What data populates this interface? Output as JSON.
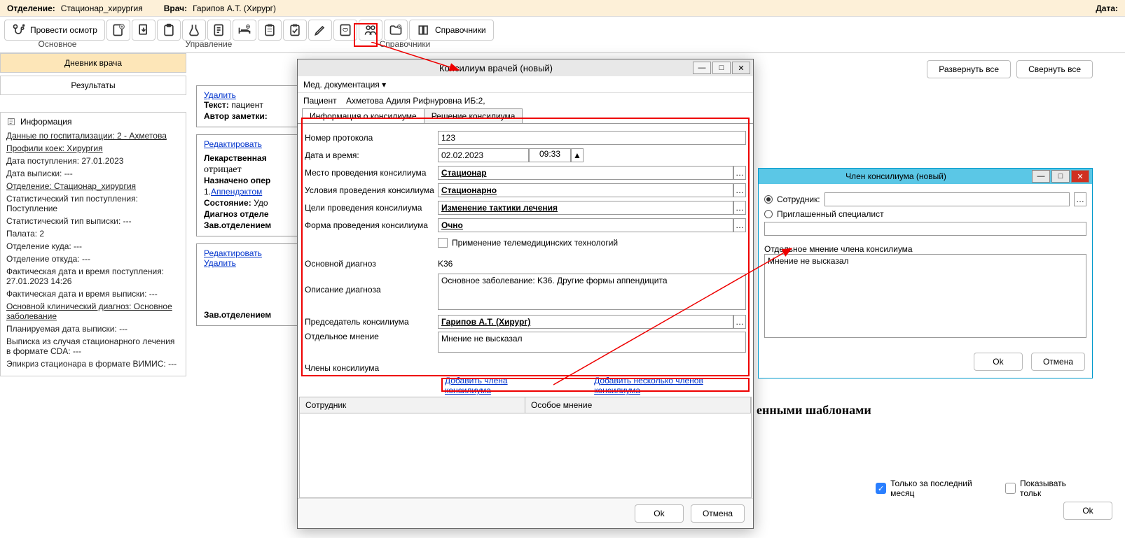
{
  "header": {
    "dept_label": "Отделение:",
    "dept_value": "Стационар_хирургия",
    "doctor_label": "Врач:",
    "doctor_value": "Гарипов А.Т. (Хирург)",
    "date_label": "Дата:"
  },
  "toolbar": {
    "examine": "Провести осмотр",
    "reference": "Справочники",
    "group_main": "Основное",
    "group_manage": "Управление",
    "group_ref": "Справочники"
  },
  "left": {
    "tab1": "Дневник врача",
    "tab2": "Результаты",
    "info_header": "Информация",
    "lines": [
      {
        "t": "Данные по госпитализации: 2 - Ахметова",
        "u": true
      },
      {
        "t": "Профили коек: Хирургия",
        "u": true
      },
      {
        "t": "Дата поступления: 27.01.2023",
        "u": false
      },
      {
        "t": "Дата выписки: ---",
        "u": false
      },
      {
        "t": "Отделение: Стационар_хирургия",
        "u": true
      },
      {
        "t": "Статистический тип поступления: Поступление",
        "u": false
      },
      {
        "t": "Статистический тип выписки: ---",
        "u": false
      },
      {
        "t": "Палата: 2",
        "u": false
      },
      {
        "t": "Отделение куда: ---",
        "u": false
      },
      {
        "t": "Отделение откуда: ---",
        "u": false
      },
      {
        "t": "Фактическая дата и время поступления: 27.01.2023 14:26",
        "u": false
      },
      {
        "t": "Фактическая дата и время выписки: ---",
        "u": false
      },
      {
        "t": "Основной клинический диагноз: Основное заболевание",
        "u": true
      },
      {
        "t": "Планируемая дата выписки: ---",
        "u": false
      },
      {
        "t": "Выписка из случая стационарного лечения в формате CDA: ---",
        "u": false
      },
      {
        "t": "Эпикриз стационара в формате ВИМИС: ---",
        "u": false
      }
    ]
  },
  "mid": {
    "expand": "Развернуть все",
    "collapse": "Свернуть все",
    "delete": "Удалить",
    "text_label": "Текст:",
    "text_val": "пациент ",
    "author_label": "Автор заметки:",
    "edit": "Редактировать",
    "rx_label": "Лекарственная",
    "rx_val": "отрицает",
    "op_label": "Назначено опер",
    "op_num": "1.",
    "op_link": "Аппендэктом",
    "state_label": "Состояние:",
    "state_val": "Удо",
    "diag_label": "Диагноз отделе",
    "head_label": "Зав.отделением",
    "templates_label": "енными шаблонами",
    "last_month": "Только за последний месяц",
    "show_only": "Показывать тольк",
    "ok": "Ok"
  },
  "modal": {
    "title": "Консилиум врачей (новый)",
    "menu": "Мед. документация ▾",
    "patient_label": "Пациент",
    "patient_value": "Ахметова Адиля Рифнуровна ИБ:2,",
    "tab_info": "Информация о консилиуме",
    "tab_decision": "Решение консилиума",
    "f_protocol": "Номер протокола",
    "v_protocol": "123",
    "f_datetime": "Дата и время:",
    "v_date": "02.02.2023",
    "v_time": "09:33",
    "f_place": "Место проведения консилиума",
    "v_place": "Стационар",
    "f_cond": "Условия проведения консилиума",
    "v_cond": "Стационарно",
    "f_goal": "Цели проведения консилиума",
    "v_goal": "Изменение тактики лечения",
    "f_form": "Форма проведения консилиума",
    "v_form": "Очно",
    "f_tele": "Применение телемедицинских технологий",
    "f_maind": "Основной диагноз",
    "v_maind": "K36",
    "f_descd": "Описание диагноза",
    "v_descd": "Основное заболевание: K36. Другие формы аппендицита",
    "f_chair": "Председатель консилиума",
    "v_chair": "Гарипов А.Т. (Хирург)",
    "f_opinion": "Отдельное мнение",
    "v_opinion": "Мнение не высказал",
    "members_label": "Члены консилиума",
    "add_one": "Добавить члена консилиума",
    "add_many": "Добавить несколько членов консилиума",
    "col_emp": "Сотрудник",
    "col_op": "Особое мнение",
    "ok": "Ok",
    "cancel": "Отмена"
  },
  "modal2": {
    "title": "Член консилиума (новый)",
    "r_employee": "Сотрудник:",
    "r_guest": "Приглашенный специалист",
    "opinion_label": "Отдельное мнение члена консилиума",
    "opinion_val": "Мнение не высказал",
    "ok": "Ok",
    "cancel": "Отмена"
  }
}
